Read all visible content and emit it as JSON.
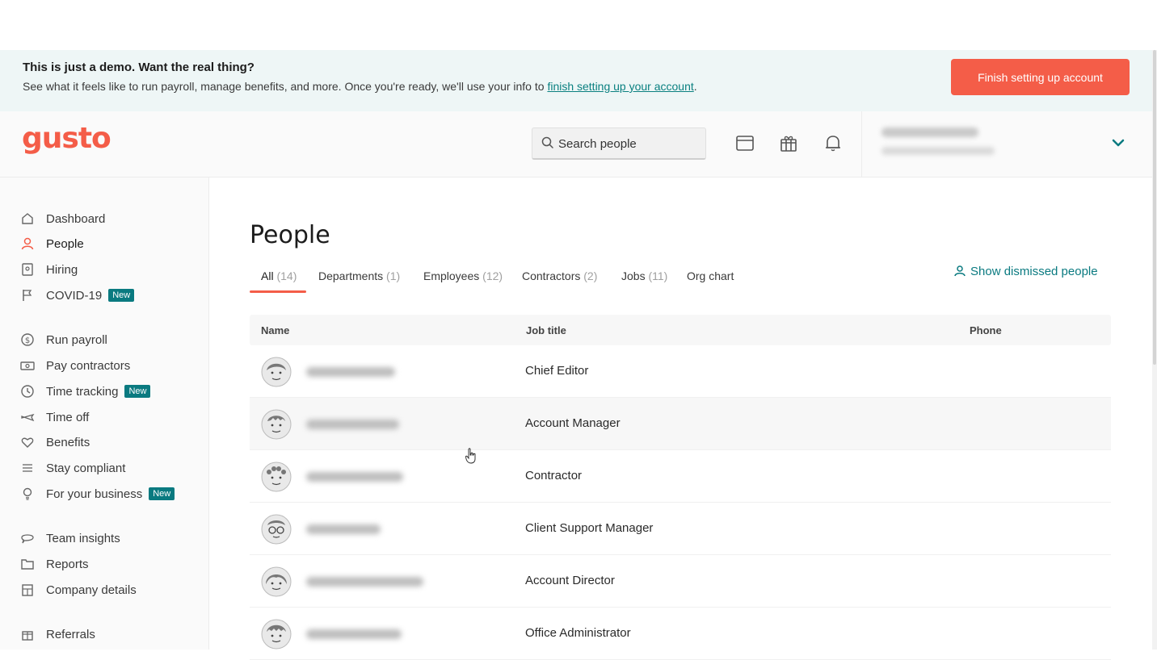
{
  "banner": {
    "title": "This is just a demo. Want the real thing?",
    "text_before": "See what it feels like to run payroll, manage benefits, and more. Once you're ready, we'll use your info to ",
    "link": "finish setting up your account",
    "text_after": ".",
    "button_label": "Finish setting up account"
  },
  "header": {
    "logo": "gusto",
    "search_placeholder": "Search people",
    "icons": [
      "calendar-icon",
      "gift-icon",
      "bell-icon"
    ]
  },
  "sidebar": {
    "items": [
      {
        "label": "Dashboard",
        "icon": "home-icon"
      },
      {
        "label": "People",
        "icon": "people-icon",
        "active": true
      },
      {
        "label": "Hiring",
        "icon": "id-card-icon"
      },
      {
        "label": "COVID-19",
        "icon": "flag-icon",
        "badge": "New"
      },
      {
        "label": "Run payroll",
        "icon": "dollar-icon"
      },
      {
        "label": "Pay contractors",
        "icon": "money-icon"
      },
      {
        "label": "Time tracking",
        "icon": "clock-icon",
        "badge": "New"
      },
      {
        "label": "Time off",
        "icon": "plane-icon"
      },
      {
        "label": "Benefits",
        "icon": "heart-icon"
      },
      {
        "label": "Stay compliant",
        "icon": "list-icon"
      },
      {
        "label": "For your business",
        "icon": "bulb-icon",
        "badge": "New"
      },
      {
        "label": "Team insights",
        "icon": "chat-icon"
      },
      {
        "label": "Reports",
        "icon": "folder-icon"
      },
      {
        "label": "Company details",
        "icon": "building-icon"
      },
      {
        "label": "Referrals",
        "icon": "gift-icon"
      }
    ]
  },
  "main": {
    "title": "People",
    "tabs": [
      {
        "label": "All",
        "count": "(14)"
      },
      {
        "label": "Departments",
        "count": "(1)"
      },
      {
        "label": "Employees",
        "count": "(12)"
      },
      {
        "label": "Contractors",
        "count": "(2)"
      },
      {
        "label": "Jobs",
        "count": "(11)"
      },
      {
        "label": "Org chart",
        "count": ""
      }
    ],
    "show_dismissed": "Show dismissed people",
    "columns": [
      "Name",
      "Job title",
      "Phone"
    ],
    "rows": [
      {
        "job_title": "Chief Editor"
      },
      {
        "job_title": "Account Manager"
      },
      {
        "job_title": "Contractor"
      },
      {
        "job_title": "Client Support Manager"
      },
      {
        "job_title": "Account Director"
      },
      {
        "job_title": "Office Administrator"
      }
    ]
  },
  "colors": {
    "brand": "#f45d48",
    "teal": "#0a7a80",
    "banner_bg": "#eef6f6"
  }
}
